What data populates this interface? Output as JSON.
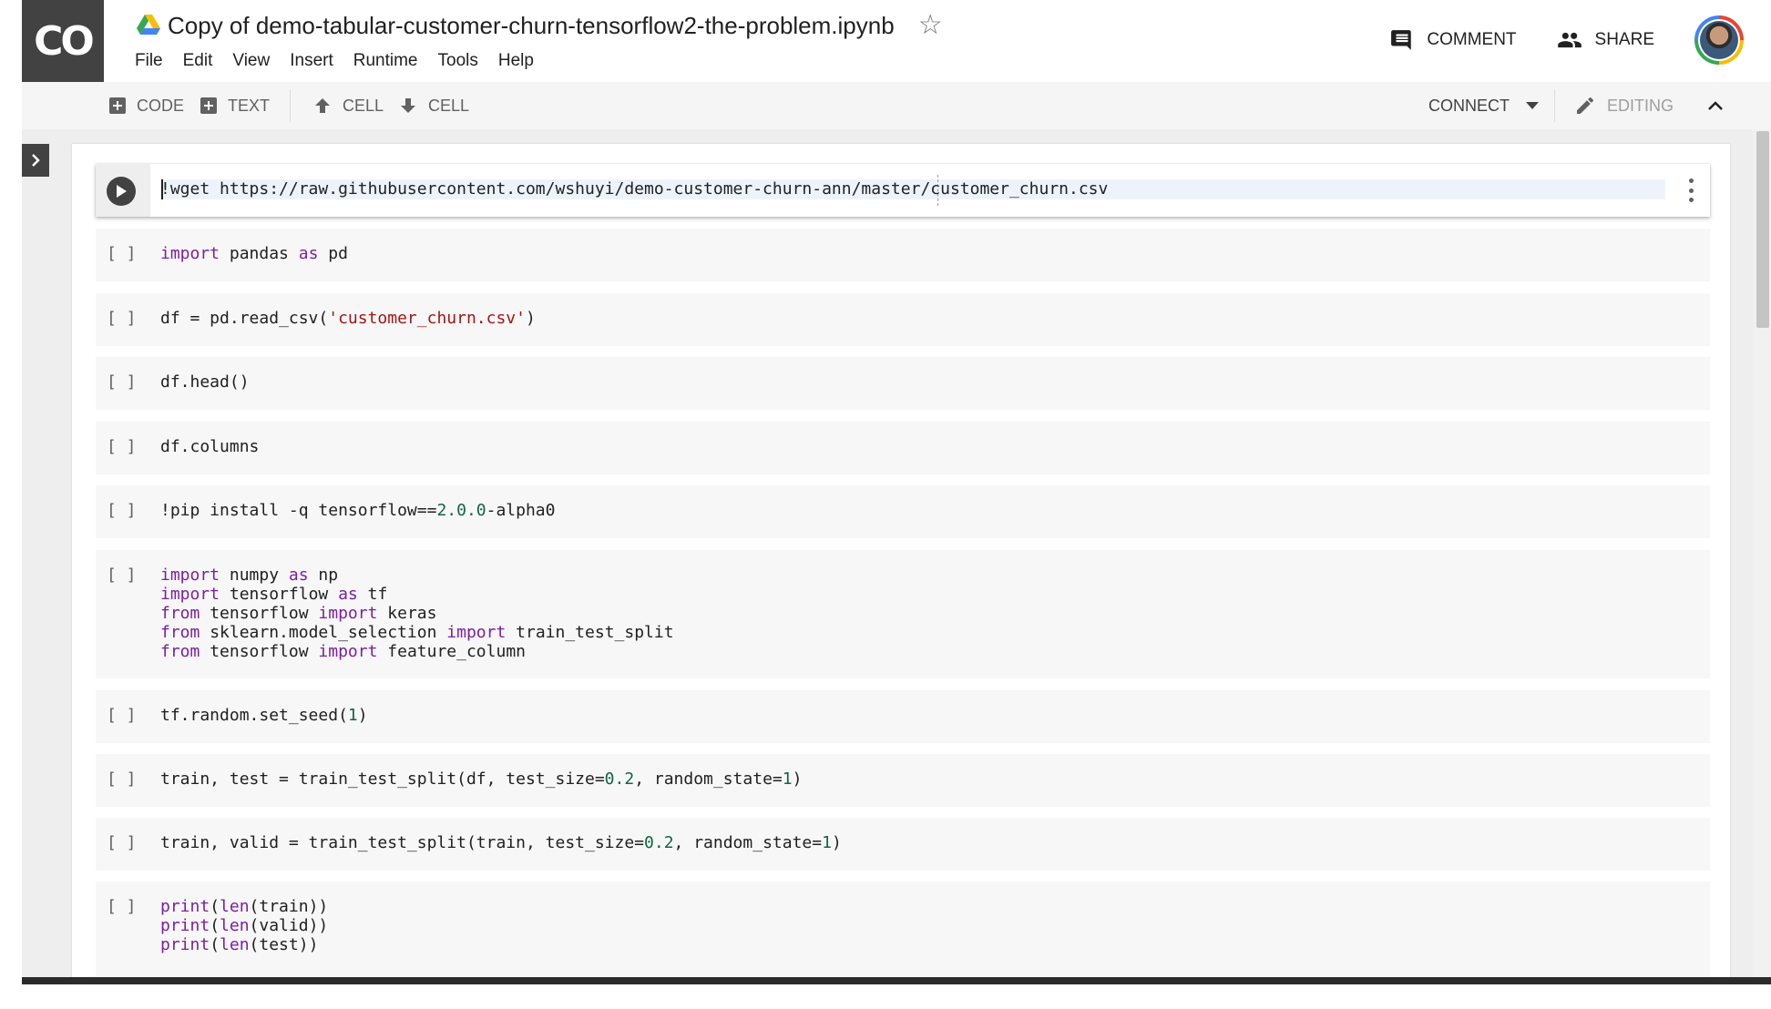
{
  "header": {
    "logo": "CO",
    "title": "Copy of demo-tabular-customer-churn-tensorflow2-the-problem.ipynb",
    "menu": [
      "File",
      "Edit",
      "View",
      "Insert",
      "Runtime",
      "Tools",
      "Help"
    ],
    "comment_label": "COMMENT",
    "share_label": "SHARE"
  },
  "toolbar": {
    "add_code": "CODE",
    "add_text": "TEXT",
    "cell_up": "CELL",
    "cell_down": "CELL",
    "connect": "CONNECT",
    "editing": "EDITING"
  },
  "cells": [
    {
      "num": "",
      "active": true,
      "lines": [
        [
          {
            "t": "!wget https://raw.githubusercontent.com/wshuyi/demo-customer-churn-ann/master/customer_churn.csv",
            "c": ""
          }
        ]
      ]
    },
    {
      "num": "[ ]",
      "lines": [
        [
          {
            "t": "import",
            "c": "kw"
          },
          {
            "t": " pandas ",
            "c": ""
          },
          {
            "t": "as",
            "c": "kw"
          },
          {
            "t": " pd",
            "c": ""
          }
        ]
      ]
    },
    {
      "num": "[ ]",
      "lines": [
        [
          {
            "t": "df = pd.read_csv(",
            "c": ""
          },
          {
            "t": "'customer_churn.csv'",
            "c": "str"
          },
          {
            "t": ")",
            "c": ""
          }
        ]
      ]
    },
    {
      "num": "[ ]",
      "lines": [
        [
          {
            "t": "df.head()",
            "c": ""
          }
        ]
      ]
    },
    {
      "num": "[ ]",
      "lines": [
        [
          {
            "t": "df.columns",
            "c": ""
          }
        ]
      ]
    },
    {
      "num": "[ ]",
      "lines": [
        [
          {
            "t": "!pip install -q tensorflow==",
            "c": ""
          },
          {
            "t": "2.0.0",
            "c": "num"
          },
          {
            "t": "-alpha0",
            "c": ""
          }
        ]
      ]
    },
    {
      "num": "[ ]",
      "lines": [
        [
          {
            "t": "import",
            "c": "kw"
          },
          {
            "t": " numpy ",
            "c": ""
          },
          {
            "t": "as",
            "c": "kw"
          },
          {
            "t": " np",
            "c": ""
          }
        ],
        [
          {
            "t": "import",
            "c": "kw"
          },
          {
            "t": " tensorflow ",
            "c": ""
          },
          {
            "t": "as",
            "c": "kw"
          },
          {
            "t": " tf",
            "c": ""
          }
        ],
        [
          {
            "t": "from",
            "c": "kw"
          },
          {
            "t": " tensorflow ",
            "c": ""
          },
          {
            "t": "import",
            "c": "kw"
          },
          {
            "t": " keras",
            "c": ""
          }
        ],
        [
          {
            "t": "from",
            "c": "kw"
          },
          {
            "t": " sklearn.model_selection ",
            "c": ""
          },
          {
            "t": "import",
            "c": "kw"
          },
          {
            "t": " train_test_split",
            "c": ""
          }
        ],
        [
          {
            "t": "from",
            "c": "kw"
          },
          {
            "t": " tensorflow ",
            "c": ""
          },
          {
            "t": "import",
            "c": "kw"
          },
          {
            "t": " feature_column",
            "c": ""
          }
        ]
      ]
    },
    {
      "num": "[ ]",
      "lines": [
        [
          {
            "t": "tf.random.set_seed(",
            "c": ""
          },
          {
            "t": "1",
            "c": "num"
          },
          {
            "t": ")",
            "c": ""
          }
        ]
      ]
    },
    {
      "num": "[ ]",
      "lines": [
        [
          {
            "t": "train, test = train_test_split(df, test_size=",
            "c": ""
          },
          {
            "t": "0.2",
            "c": "num"
          },
          {
            "t": ", random_state=",
            "c": ""
          },
          {
            "t": "1",
            "c": "num"
          },
          {
            "t": ")",
            "c": ""
          }
        ]
      ]
    },
    {
      "num": "[ ]",
      "lines": [
        [
          {
            "t": "train, valid = train_test_split(train, test_size=",
            "c": ""
          },
          {
            "t": "0.2",
            "c": "num"
          },
          {
            "t": ", random_state=",
            "c": ""
          },
          {
            "t": "1",
            "c": "num"
          },
          {
            "t": ")",
            "c": ""
          }
        ]
      ]
    },
    {
      "num": "[ ]",
      "lines": [
        [
          {
            "t": "print",
            "c": "kw"
          },
          {
            "t": "(",
            "c": ""
          },
          {
            "t": "len",
            "c": "kw"
          },
          {
            "t": "(train))",
            "c": ""
          }
        ],
        [
          {
            "t": "print",
            "c": "kw"
          },
          {
            "t": "(",
            "c": ""
          },
          {
            "t": "len",
            "c": "kw"
          },
          {
            "t": "(valid))",
            "c": ""
          }
        ],
        [
          {
            "t": "print",
            "c": "kw"
          },
          {
            "t": "(",
            "c": ""
          },
          {
            "t": "len",
            "c": "kw"
          },
          {
            "t": "(test))",
            "c": ""
          }
        ]
      ]
    }
  ],
  "colors": {
    "logo_bg": "#424242",
    "toolbar_bg": "#f5f5f5",
    "keyword": "#7b1fa2",
    "string": "#a31515",
    "number": "#116644"
  },
  "icons": [
    "drive-icon",
    "star-icon",
    "comment-icon",
    "share-people-icon",
    "avatar",
    "plus-box-icon",
    "arrow-up-icon",
    "arrow-down-icon",
    "dropdown-arrow-icon",
    "pencil-icon",
    "chevron-up-icon",
    "chevron-right-icon",
    "run-icon",
    "more-vert-icon"
  ]
}
